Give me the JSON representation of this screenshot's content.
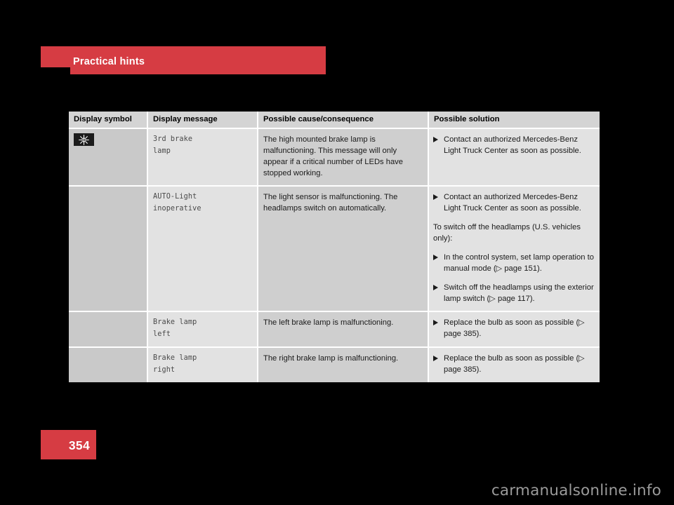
{
  "chapter": {
    "title": "Practical hints",
    "banner_color": "#d63c43"
  },
  "page": {
    "number": "354",
    "badge_color": "#d63c43"
  },
  "watermark": {
    "text": "carmanualsonline.info"
  },
  "table": {
    "headers": [
      "Display symbol",
      "Display message",
      "Possible cause/consequence",
      "Possible solution"
    ],
    "rows": [
      {
        "symbol": "brake-lamp-indicator-icon",
        "message_line1": "3rd brake",
        "message_line2": "lamp",
        "cause": "The high mounted brake lamp is malfunctioning. This message will only appear if a critical number of LEDs have stopped working.",
        "solution": [
          {
            "kind": "bullet",
            "text": "Contact an authorized Mercedes-Benz Light Truck Center as soon as possible."
          }
        ]
      },
      {
        "symbol": "",
        "message_line1": "AUTO-Light",
        "message_line2": "inoperative",
        "cause": "The light sensor is malfunctioning. The headlamps switch on automatically.",
        "solution": [
          {
            "kind": "bullet",
            "text": "Contact an authorized Mercedes-Benz Light Truck Center as soon as possible."
          },
          {
            "kind": "paragraph",
            "text": "To switch off the headlamps (U.S. vehicles only):"
          },
          {
            "kind": "bullet",
            "text": "In the control system, set lamp operation to manual mode (▷ page 151)."
          },
          {
            "kind": "bullet",
            "text": "Switch off the headlamps using the exterior lamp switch (▷ page 117)."
          }
        ]
      },
      {
        "symbol": "",
        "message_line1": "Brake lamp",
        "message_line2": "left",
        "cause": "The left brake lamp is malfunctioning.",
        "solution": [
          {
            "kind": "bullet",
            "text": "Replace the bulb as soon as possible (▷ page 385)."
          }
        ]
      },
      {
        "symbol": "",
        "message_line1": "Brake lamp",
        "message_line2": "right",
        "cause": "The right brake lamp is malfunctioning.",
        "solution": [
          {
            "kind": "bullet",
            "text": "Replace the bulb as soon as possible (▷ page 385)."
          }
        ]
      }
    ]
  }
}
